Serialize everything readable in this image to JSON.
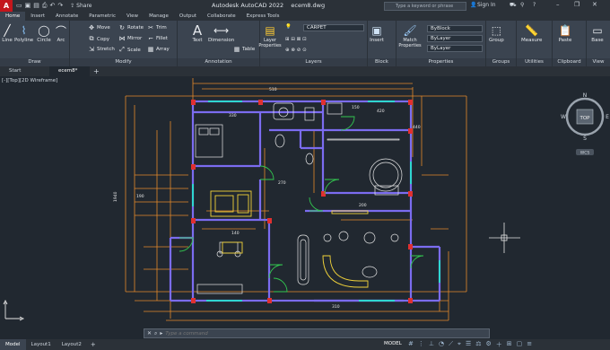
{
  "app": {
    "logo": "A",
    "title": "Autodesk AutoCAD 2022",
    "file": "ecem8.dwg",
    "share_label": "Share",
    "search_placeholder": "Type a keyword or phrase",
    "sign_in": "Sign In"
  },
  "ribbon_tabs": [
    "Home",
    "Insert",
    "Annotate",
    "Parametric",
    "View",
    "Manage",
    "Output",
    "Collaborate",
    "Express Tools"
  ],
  "ribbon": {
    "draw": {
      "title": "Draw",
      "line": "Line",
      "polyline": "Polyline",
      "circle": "Circle",
      "arc": "Arc"
    },
    "modify": {
      "title": "Modify",
      "move": "Move",
      "copy": "Copy",
      "stretch": "Stretch",
      "rotate": "Rotate",
      "mirror": "Mirror",
      "scale": "Scale",
      "trim": "Trim",
      "fillet": "Fillet",
      "array": "Array"
    },
    "annotation": {
      "title": "Annotation",
      "text": "Text",
      "dimension": "Dimension",
      "table": "Table"
    },
    "layers": {
      "title": "Layers",
      "layer_properties": "Layer Properties",
      "current_layer": "CARPET"
    },
    "block": {
      "title": "Block",
      "insert": "Insert"
    },
    "properties": {
      "title": "Properties",
      "match": "Match Properties",
      "color": "ByBlock",
      "linetype": "ByLayer",
      "lineweight": "ByLayer"
    },
    "groups": {
      "title": "Groups",
      "group": "Group"
    },
    "utilities": {
      "title": "Utilities",
      "measure": "Measure"
    },
    "clipboard": {
      "title": "Clipboard",
      "paste": "Paste"
    },
    "view": {
      "title": "View",
      "base": "Base"
    }
  },
  "file_tabs": [
    "Start",
    "ecem8*"
  ],
  "viewport": {
    "label": "[-][Top][2D Wireframe]"
  },
  "navcube": {
    "top": "TOP",
    "n": "N",
    "s": "S",
    "e": "E",
    "w": "W",
    "wcs": "WCS"
  },
  "dims": {
    "d1": "330",
    "d2": "150",
    "d3": "200",
    "d4": "270",
    "d5": "140",
    "d6": "190",
    "d7": "420",
    "d8": "510",
    "d9": "440",
    "d10": "310",
    "d11": "1940"
  },
  "command": {
    "placeholder": "Type a command"
  },
  "layout_tabs": [
    "Model",
    "Layout1",
    "Layout2"
  ],
  "status": {
    "model": "MODEL"
  }
}
